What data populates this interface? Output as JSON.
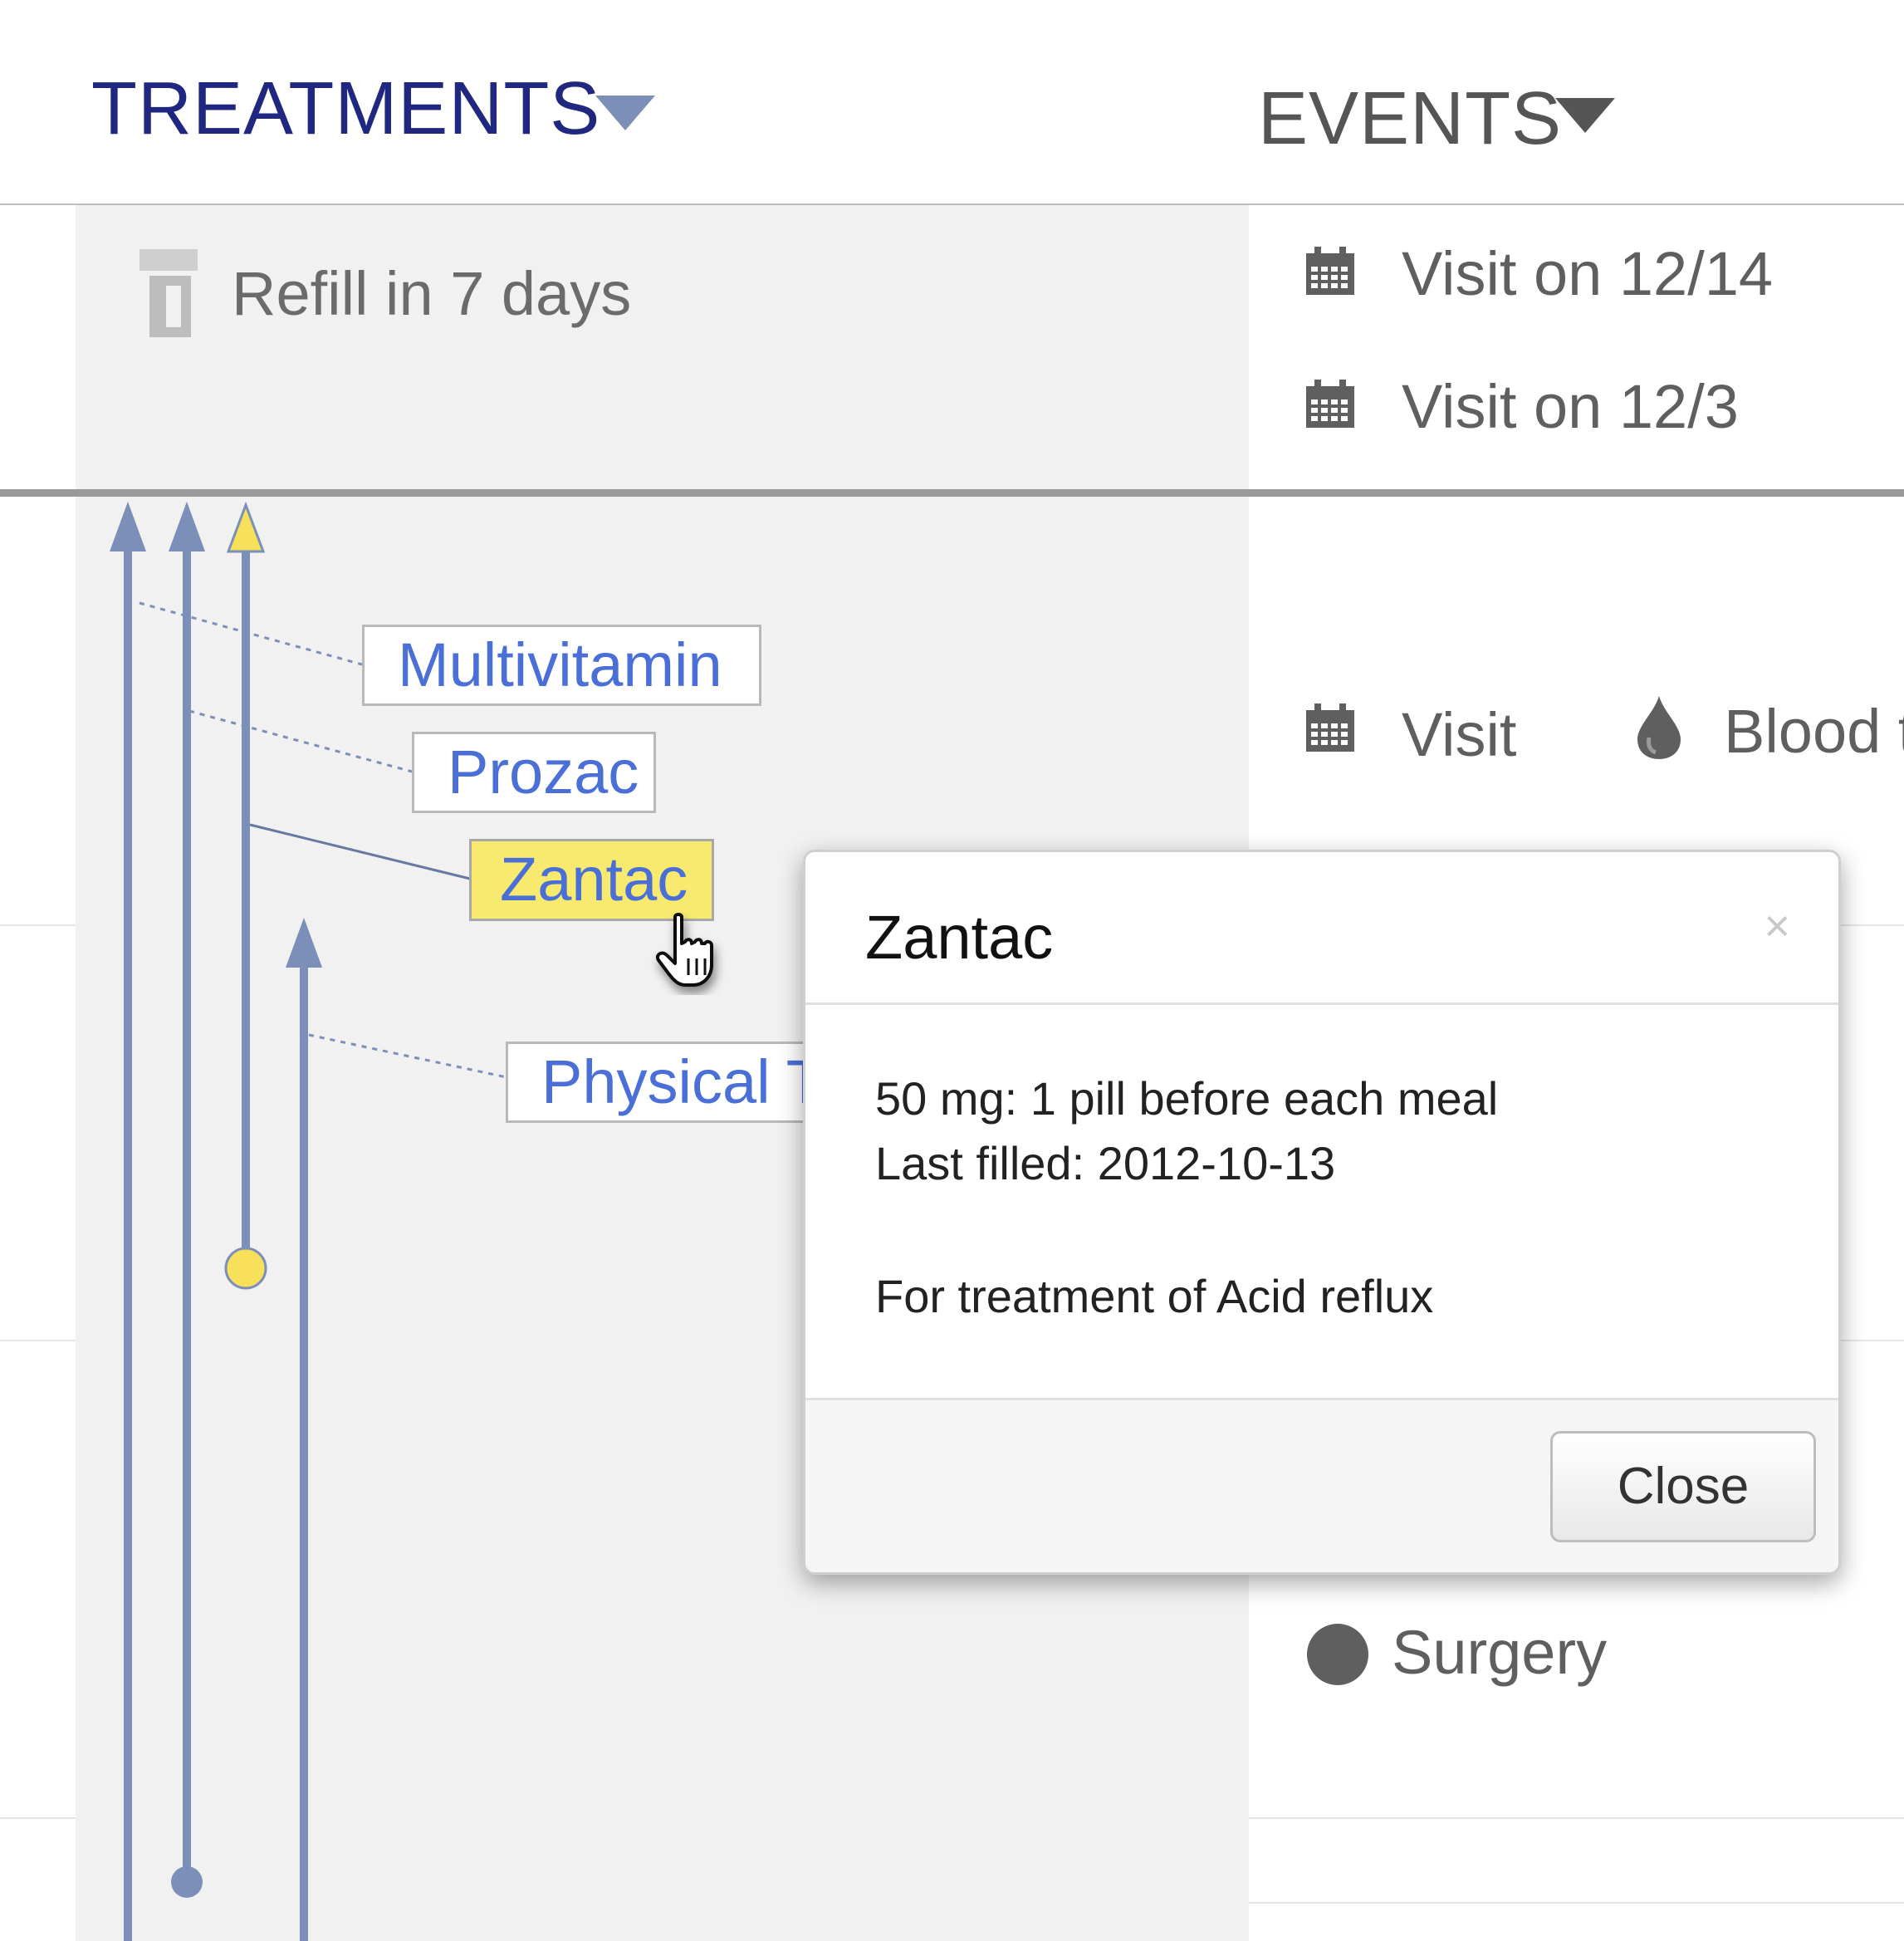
{
  "header": {
    "treatments_label": "TREATMENTS",
    "events_label": "EVENTS"
  },
  "upcoming": {
    "refill_text": "Refill in 7 days",
    "events": [
      "Visit on 12/14",
      "Visit on 12/3"
    ]
  },
  "treatments": [
    {
      "name": "Multivitamin",
      "selected": false
    },
    {
      "name": "Prozac",
      "selected": false
    },
    {
      "name": "Zantac",
      "selected": true
    },
    {
      "name": "Physical Therapy",
      "selected": false
    }
  ],
  "events": {
    "row1": {
      "visit": "Visit",
      "blood": "Blood test"
    },
    "row2": {
      "surgery": "Surgery"
    }
  },
  "modal": {
    "title": "Zantac",
    "dose_line": "50 mg: 1 pill before each meal",
    "filled_line": "Last filled: 2012-10-13",
    "purpose_line": "For treatment of Acid reflux",
    "close_label": "Close",
    "close_icon": "×"
  },
  "colors": {
    "treatment_line": "#7b8fb8",
    "selected": "#f7e15a",
    "header_accent": "#1f2780",
    "label_text": "#4a6fd6"
  },
  "icons": {
    "refill": "pill-bottle-icon",
    "visit": "calendar-icon",
    "blood": "blood-drop-icon",
    "surgery": "surgery-dot-icon",
    "cursor": "hand-pointer-icon"
  }
}
